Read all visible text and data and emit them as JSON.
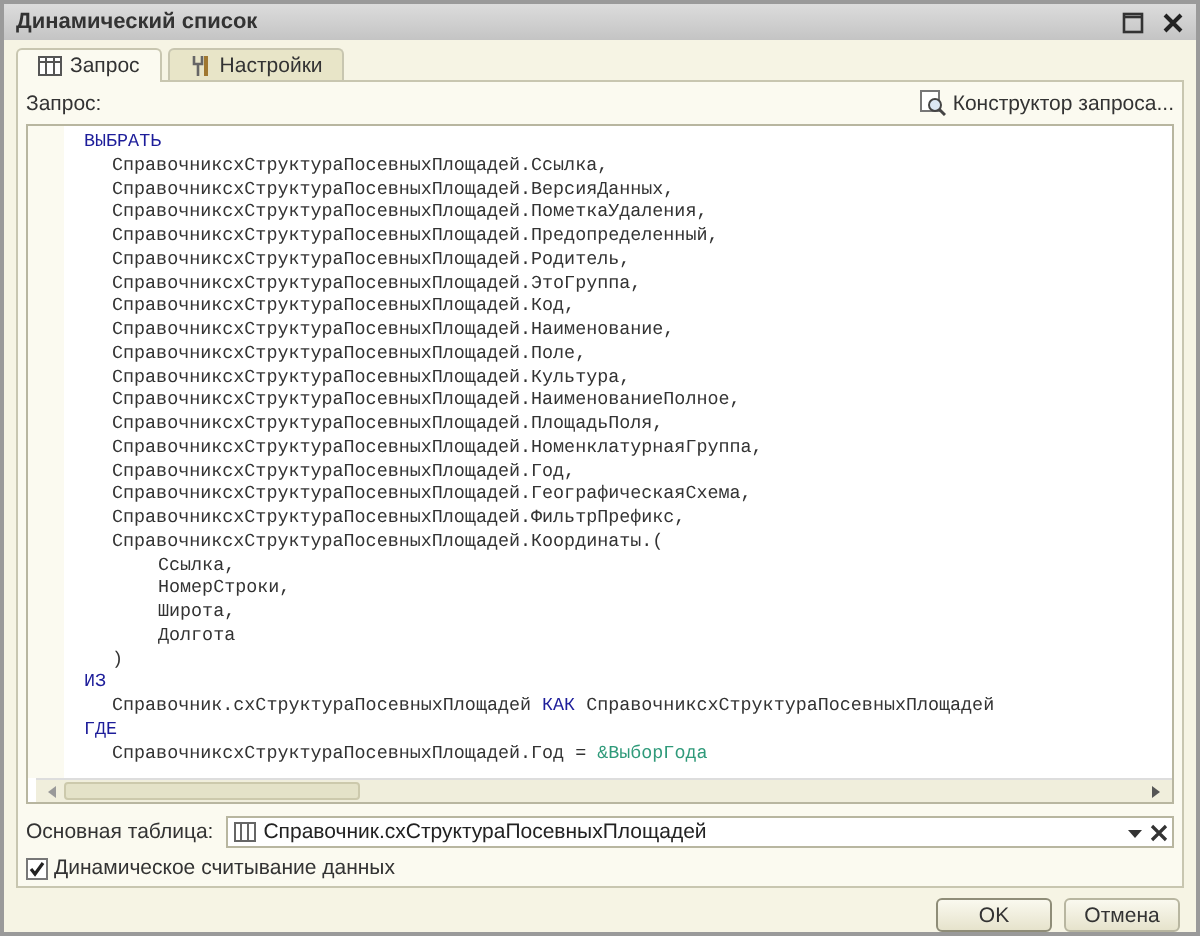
{
  "window": {
    "title": "Динамический список",
    "buttons": [
      {
        "kind": "maximize"
      },
      {
        "kind": "close"
      }
    ]
  },
  "tabs": [
    {
      "label": "Запрос",
      "kind": "table",
      "selected": true
    },
    {
      "label": "Настройки",
      "kind": "settings",
      "selected": false
    }
  ],
  "query": {
    "label": "Запрос:",
    "constructor_button": "Конструктор запроса...",
    "lines": [
      {
        "kind": "keyword",
        "parts": [
          {
            "text": "ВЫБРАТЬ",
            "kind": "keyword"
          }
        ]
      },
      {
        "kind": "item",
        "parts": [
          {
            "text": "СправочниксхСтруктураПосевныхПлощадей.Ссылка,",
            "kind": "plain"
          }
        ]
      },
      {
        "kind": "item",
        "parts": [
          {
            "text": "СправочниксхСтруктураПосевныхПлощадей.ВерсияДанных,",
            "kind": "plain"
          }
        ]
      },
      {
        "kind": "item",
        "parts": [
          {
            "text": "СправочниксхСтруктураПосевныхПлощадей.ПометкаУдаления,",
            "kind": "plain"
          }
        ]
      },
      {
        "kind": "item",
        "parts": [
          {
            "text": "СправочниксхСтруктураПосевныхПлощадей.Предопределенный,",
            "kind": "plain"
          }
        ]
      },
      {
        "kind": "item",
        "parts": [
          {
            "text": "СправочниксхСтруктураПосевныхПлощадей.Родитель,",
            "kind": "plain"
          }
        ]
      },
      {
        "kind": "item",
        "parts": [
          {
            "text": "СправочниксхСтруктураПосевныхПлощадей.ЭтоГруппа,",
            "kind": "plain"
          }
        ]
      },
      {
        "kind": "item",
        "parts": [
          {
            "text": "СправочниксхСтруктураПосевныхПлощадей.Код,",
            "kind": "plain"
          }
        ]
      },
      {
        "kind": "item",
        "parts": [
          {
            "text": "СправочниксхСтруктураПосевныхПлощадей.Наименование,",
            "kind": "plain"
          }
        ]
      },
      {
        "kind": "item",
        "parts": [
          {
            "text": "СправочниксхСтруктураПосевныхПлощадей.Поле,",
            "kind": "plain"
          }
        ]
      },
      {
        "kind": "item",
        "parts": [
          {
            "text": "СправочниксхСтруктураПосевныхПлощадей.Культура,",
            "kind": "plain"
          }
        ]
      },
      {
        "kind": "item",
        "parts": [
          {
            "text": "СправочниксхСтруктураПосевныхПлощадей.НаименованиеПолное,",
            "kind": "plain"
          }
        ]
      },
      {
        "kind": "item",
        "parts": [
          {
            "text": "СправочниксхСтруктураПосевныхПлощадей.ПлощадьПоля,",
            "kind": "plain"
          }
        ]
      },
      {
        "kind": "item",
        "parts": [
          {
            "text": "СправочниксхСтруктураПосевныхПлощадей.НоменклатурнаяГруппа,",
            "kind": "plain"
          }
        ]
      },
      {
        "kind": "item",
        "parts": [
          {
            "text": "СправочниксхСтруктураПосевныхПлощадей.Год,",
            "kind": "plain"
          }
        ]
      },
      {
        "kind": "item",
        "parts": [
          {
            "text": "СправочниксхСтруктураПосевныхПлощадей.ГеографическаяСхема,",
            "kind": "plain"
          }
        ]
      },
      {
        "kind": "item",
        "parts": [
          {
            "text": "СправочниксхСтруктураПосевныхПлощадей.ФильтрПрефикс,",
            "kind": "plain"
          }
        ]
      },
      {
        "kind": "item",
        "parts": [
          {
            "text": "СправочниксхСтруктураПосевныхПлощадей.Координаты.(",
            "kind": "plain"
          }
        ]
      },
      {
        "kind": "subitem",
        "parts": [
          {
            "text": "Ссылка,",
            "kind": "plain"
          }
        ]
      },
      {
        "kind": "subitem",
        "parts": [
          {
            "text": "НомерСтроки,",
            "kind": "plain"
          }
        ]
      },
      {
        "kind": "subitem",
        "parts": [
          {
            "text": "Широта,",
            "kind": "plain"
          }
        ]
      },
      {
        "kind": "subitem",
        "parts": [
          {
            "text": "Долгота",
            "kind": "plain"
          }
        ]
      },
      {
        "kind": "item",
        "parts": [
          {
            "text": ")",
            "kind": "plain"
          }
        ]
      },
      {
        "kind": "keyword",
        "parts": [
          {
            "text": "ИЗ",
            "kind": "keyword"
          }
        ]
      },
      {
        "kind": "item",
        "parts": [
          {
            "text": "Справочник.схСтруктураПосевныхПлощадей ",
            "kind": "plain"
          },
          {
            "text": "КАК",
            "kind": "keyword"
          },
          {
            "text": " СправочниксхСтруктураПосевныхПлощадей",
            "kind": "plain"
          }
        ]
      },
      {
        "kind": "keyword",
        "parts": [
          {
            "text": "ГДЕ",
            "kind": "keyword"
          }
        ]
      },
      {
        "kind": "item",
        "parts": [
          {
            "text": "СправочниксхСтруктураПосевныхПлощадей.Год = ",
            "kind": "plain"
          },
          {
            "text": "&ВыборГода",
            "kind": "parameter"
          }
        ]
      }
    ]
  },
  "main_table": {
    "label": "Основная таблица:",
    "value": "Справочник.схСтруктураПосевныхПлощадей"
  },
  "dynamic_read": {
    "label": "Динамическое считывание данных",
    "checked": true
  },
  "buttons": [
    "OK",
    "Отмена"
  ]
}
